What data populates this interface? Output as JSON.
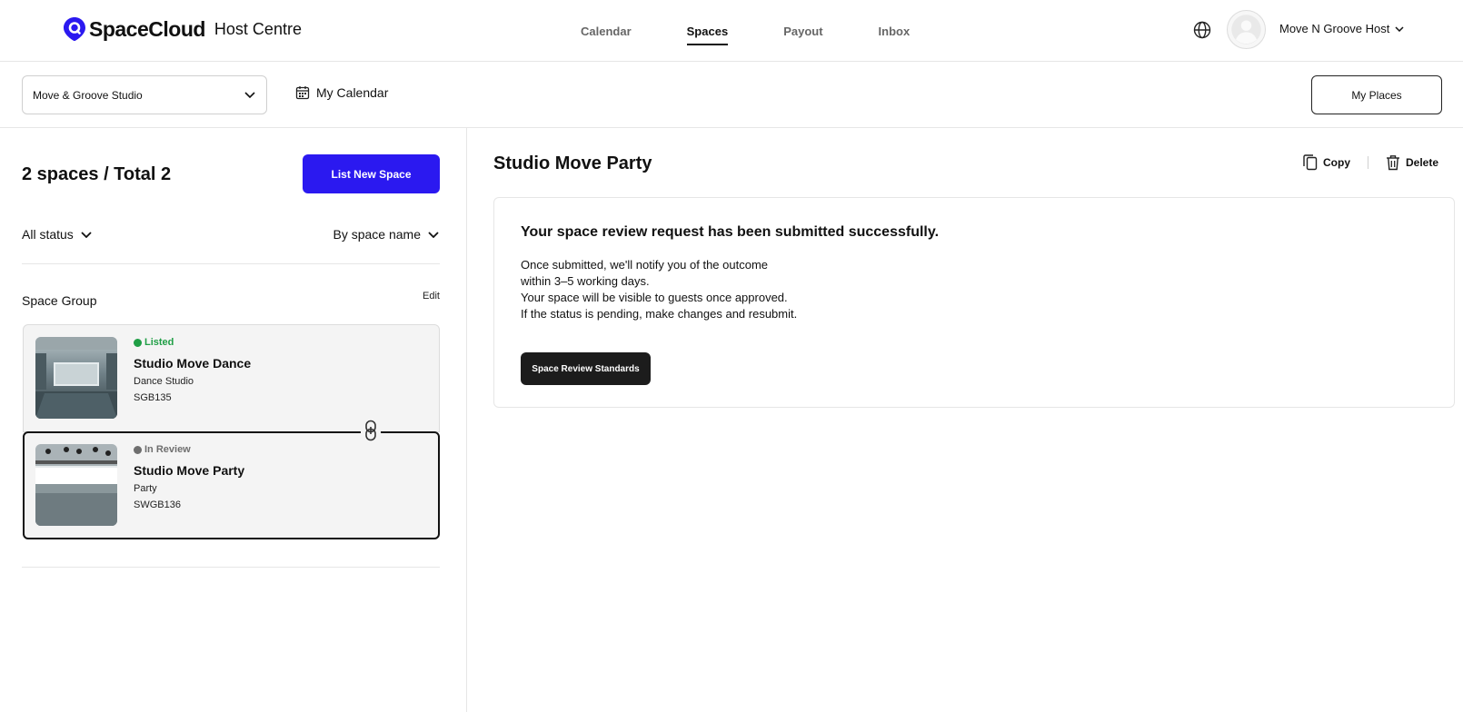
{
  "brand": {
    "name": "SpaceCloud",
    "section": "Host Centre",
    "accent_color": "#2b19f0"
  },
  "nav": {
    "items": [
      {
        "label": "Calendar",
        "active": false
      },
      {
        "label": "Spaces",
        "active": true
      },
      {
        "label": "Payout",
        "active": false
      },
      {
        "label": "Inbox",
        "active": false
      }
    ]
  },
  "header": {
    "user_name": "Move N Groove Host",
    "globe_icon": "globe-icon",
    "avatar_icon": "user-avatar-icon"
  },
  "toolbar": {
    "place_select_value": "Move & Groove Studio",
    "my_calendar_label": "My Calendar",
    "my_places_label": "My Places"
  },
  "left": {
    "count_title": "2 spaces / Total 2",
    "list_new_label": "List New Space",
    "status_filter": "All status",
    "sort_by": "By space name",
    "group_label": "Space Group",
    "edit_label": "Edit",
    "spaces": [
      {
        "status": "Listed",
        "status_color": "#1f9e45",
        "title": "Studio Move Dance",
        "type": "Dance Studio",
        "code": "SGB135",
        "selected": false
      },
      {
        "status": "In Review",
        "status_color": "#6e6e6e",
        "title": "Studio Move Party",
        "type": "Party",
        "code": "SWGB136",
        "selected": true
      }
    ]
  },
  "detail": {
    "title": "Studio Move Party",
    "copy_label": "Copy",
    "delete_label": "Delete",
    "review": {
      "heading": "Your space review request has been submitted successfully.",
      "lines": [
        "Once submitted, we'll notify you of the outcome",
        "within 3–5 working days.",
        "Your space will be visible to guests once approved.",
        "If the status is pending, make changes and resubmit."
      ],
      "button_label": "Space Review Standards"
    }
  }
}
